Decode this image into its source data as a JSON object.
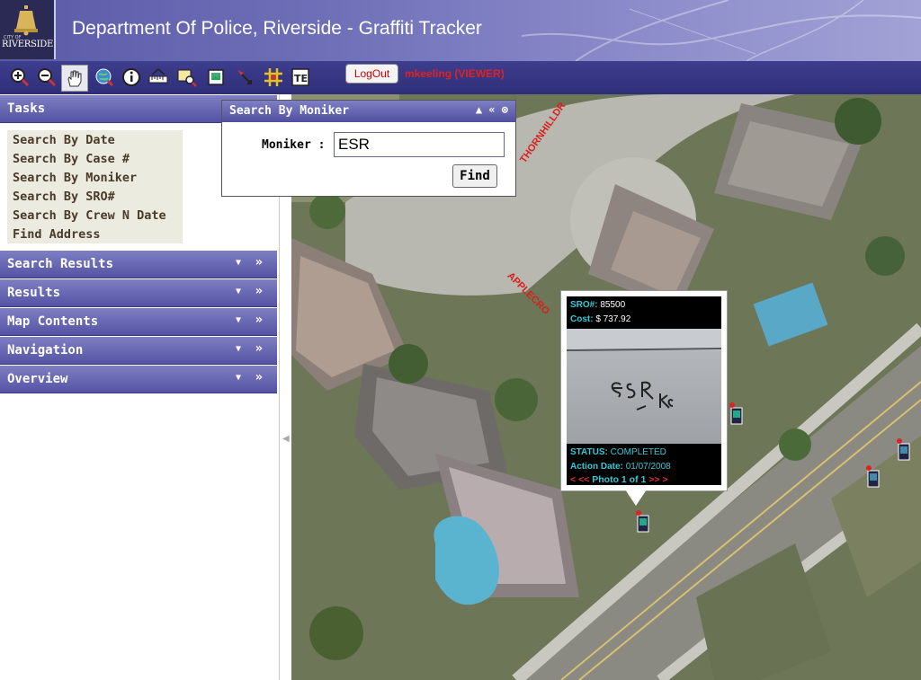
{
  "header": {
    "title": "Department Of Police, Riverside - Graffiti Tracker",
    "logo_city": "RIVERSIDE",
    "logo_prefix": "CITY OF"
  },
  "toolbar": {
    "tools": [
      "zoom-in-icon",
      "zoom-out-icon",
      "pan-hand-icon",
      "full-extent-icon",
      "identify-icon",
      "measure-icon",
      "zoom-to-selection-icon",
      "print-icon",
      "select-pointer-icon",
      "grid-icon",
      "text-tool-icon"
    ],
    "logout_label": "LogOut",
    "user_label": "mkeeling (VIEWER)"
  },
  "tasks_panel": {
    "title": "Tasks",
    "items": [
      "Search By Date",
      "Search By Case #",
      "Search By Moniker",
      "Search By SRO#",
      "Search By Crew N Date",
      "Find Address"
    ]
  },
  "panels": [
    {
      "title": "Search Results"
    },
    {
      "title": "Results"
    },
    {
      "title": "Map Contents"
    },
    {
      "title": "Navigation"
    },
    {
      "title": "Overview"
    }
  ],
  "search_dialog": {
    "title": "Search By Moniker",
    "field_label": "Moniker :",
    "field_value": "ESR",
    "find_label": "Find"
  },
  "map": {
    "street_1": "THORNHILLDR",
    "street_2": "APPLECRO"
  },
  "popup": {
    "sro_label": "SRO#:",
    "sro_value": "85500",
    "cost_label": "Cost:",
    "cost_value": "$ 737.92",
    "status_label": "STATUS:",
    "status_value": "COMPLETED",
    "date_label": "Action Date:",
    "date_value": "01/07/2008",
    "nav_prev": "< <<",
    "nav_text": "Photo 1 of 1",
    "nav_next": ">> >"
  },
  "colors": {
    "header_start": "#5a5aa8",
    "toolbar": "#2e2e7a",
    "panel_head": "#5353a3",
    "accent_red": "#d81e1e",
    "popup_text": "#35c8d8"
  }
}
